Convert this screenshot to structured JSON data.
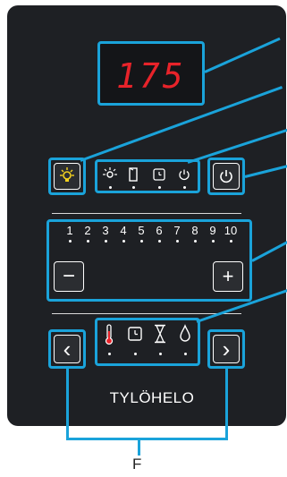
{
  "display": {
    "value": "175"
  },
  "controls": {
    "light_icon": "light-bulb-icon",
    "mode_icons": [
      "light-icon",
      "door-icon",
      "timer-icon",
      "power-small-icon"
    ],
    "power_icon": "power-icon",
    "levels": [
      "1",
      "2",
      "3",
      "4",
      "5",
      "6",
      "7",
      "8",
      "9",
      "10"
    ],
    "minus_label": "−",
    "plus_label": "+",
    "parameter_icons": [
      "thermometer-icon",
      "clock-icon",
      "hourglass-icon",
      "humidity-drop-icon"
    ],
    "prev_label": "‹",
    "next_label": "›"
  },
  "brand": "TYLÖHELO",
  "callout": "F",
  "accent_color": "#1aa3da",
  "display_color": "#e8232a"
}
